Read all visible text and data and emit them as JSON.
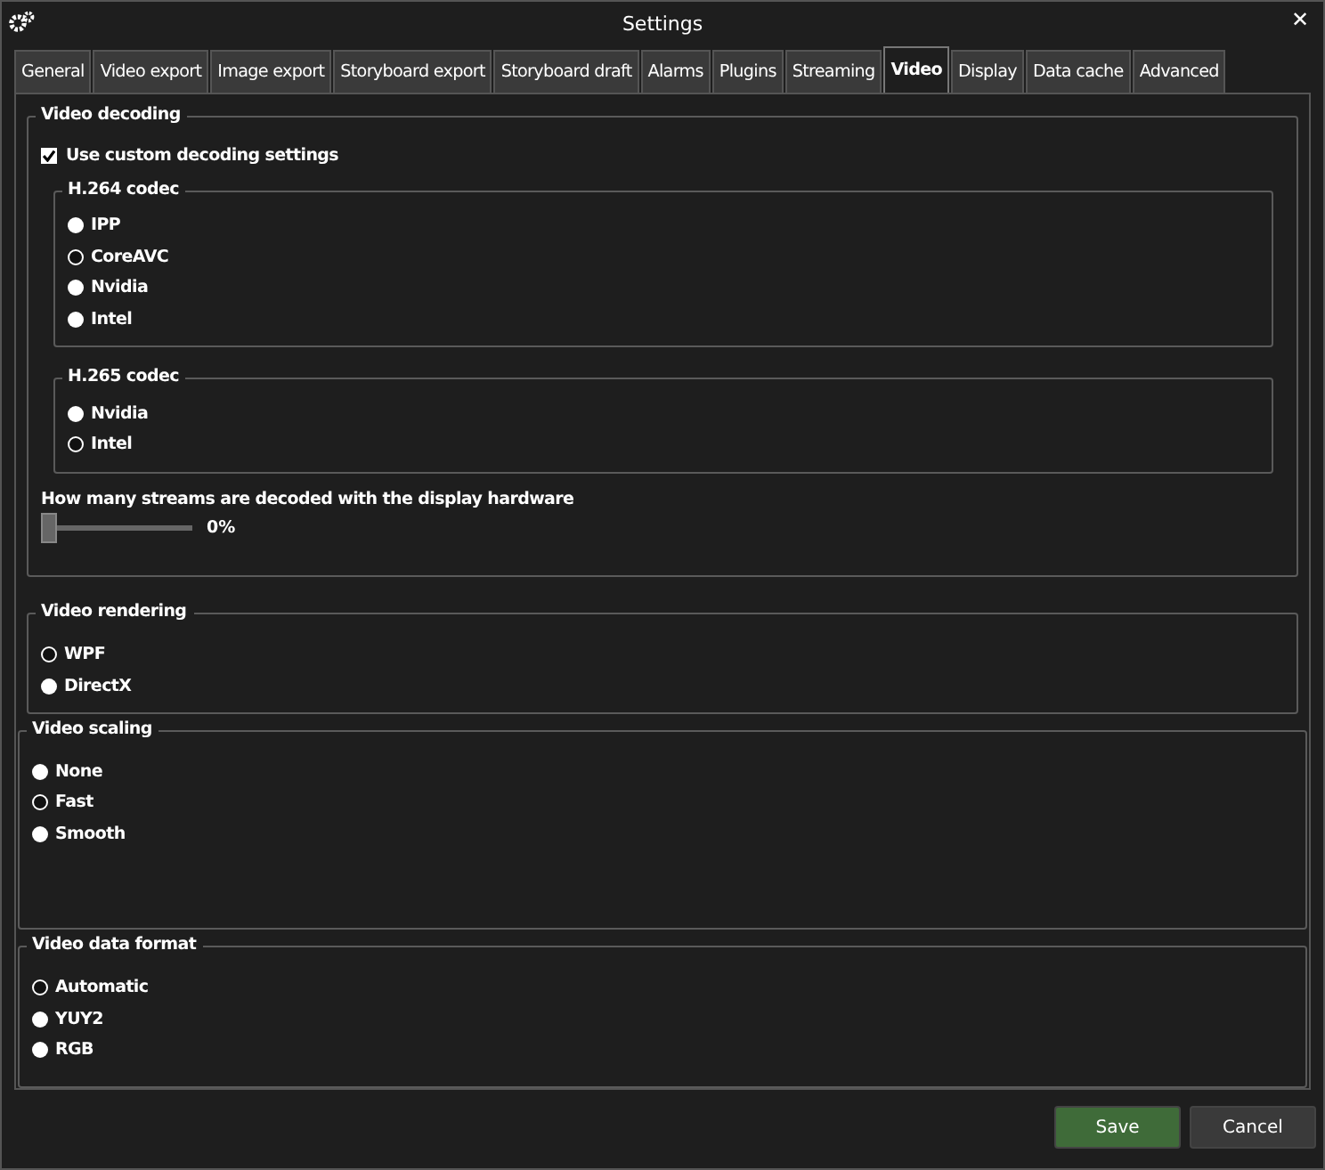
{
  "window": {
    "title": "Settings",
    "close": "✕"
  },
  "tabs": [
    {
      "label": "General",
      "selected": false
    },
    {
      "label": "Video export",
      "selected": false
    },
    {
      "label": "Image export",
      "selected": false
    },
    {
      "label": "Storyboard export",
      "selected": false
    },
    {
      "label": "Storyboard draft",
      "selected": false
    },
    {
      "label": "Alarms",
      "selected": false
    },
    {
      "label": "Plugins",
      "selected": false
    },
    {
      "label": "Streaming",
      "selected": false
    },
    {
      "label": "Video",
      "selected": true
    },
    {
      "label": "Display",
      "selected": false
    },
    {
      "label": "Data cache",
      "selected": false
    },
    {
      "label": "Advanced",
      "selected": false
    }
  ],
  "sections": [
    {
      "kind": "decoding",
      "title": "Video decoding",
      "checkbox": {
        "label": "Use custom decoding settings",
        "checked": true
      },
      "codecs": [
        {
          "title": "H.264 codec",
          "options": [
            {
              "label": "IPP",
              "selected": false
            },
            {
              "label": "CoreAVC",
              "selected": true
            },
            {
              "label": "Nvidia",
              "selected": false
            },
            {
              "label": "Intel",
              "selected": false
            }
          ]
        },
        {
          "title": "H.265 codec",
          "options": [
            {
              "label": "Nvidia",
              "selected": false
            },
            {
              "label": "Intel",
              "selected": true
            }
          ]
        }
      ],
      "slider": {
        "label": "How many streams are decoded with the display hardware",
        "level": 0,
        "reading": "0%"
      }
    },
    {
      "kind": "radio",
      "title": "Video rendering",
      "options": [
        {
          "label": "WPF",
          "selected": true
        },
        {
          "label": "DirectX",
          "selected": false
        }
      ]
    },
    {
      "kind": "radio",
      "title": "Video scaling",
      "options": [
        {
          "label": "None",
          "selected": false
        },
        {
          "label": "Fast",
          "selected": true
        },
        {
          "label": "Smooth",
          "selected": false
        }
      ]
    },
    {
      "kind": "radio",
      "title": "Video data format",
      "options": [
        {
          "label": "Automatic",
          "selected": true
        },
        {
          "label": "YUY2",
          "selected": false
        },
        {
          "label": "RGB",
          "selected": false
        }
      ]
    }
  ],
  "buttons": [
    {
      "label": "Save",
      "kind": "primary"
    },
    {
      "label": "Cancel",
      "kind": "secondary"
    }
  ]
}
